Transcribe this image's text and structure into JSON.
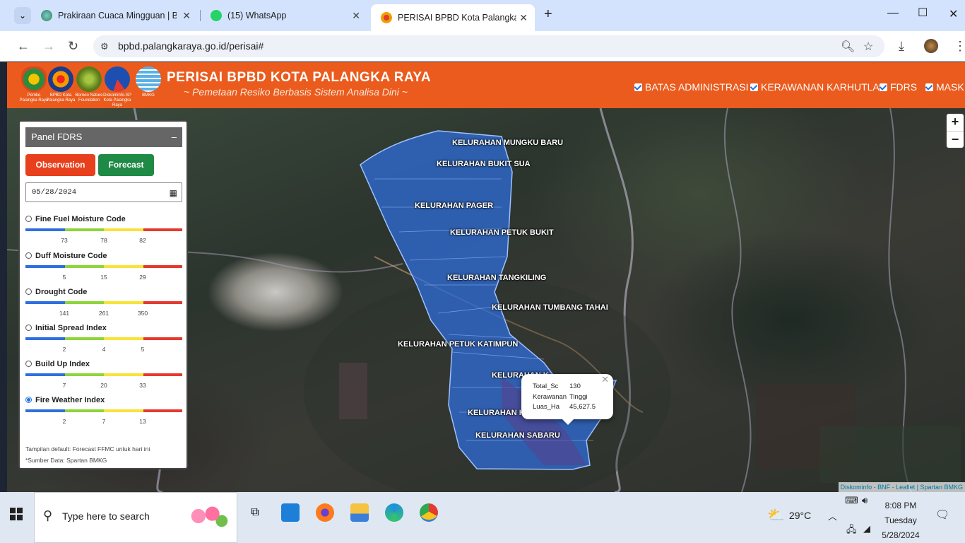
{
  "browser": {
    "tabs": [
      {
        "title": "Prakiraan Cuaca Mingguan | BM",
        "active": false
      },
      {
        "title": "(15) WhatsApp",
        "active": false
      },
      {
        "title": "PERISAI BPBD Kota Palangka Ra",
        "active": true
      }
    ],
    "url": "bpbd.palangkaraya.go.id/perisai#"
  },
  "header": {
    "title": "PERISAI BPBD KOTA PALANGKA RAYA",
    "subtitle": "~ Pemetaan Resiko Berbasis Sistem Analisa Dini ~",
    "logos": [
      {
        "caption": "Pemko Palangka Raya"
      },
      {
        "caption": "BPBD Kota Palangka Raya"
      },
      {
        "caption": "Borneo Nature Foundation"
      },
      {
        "caption": "Diskominfo-SP Kota Palangka Raya"
      },
      {
        "caption": "BMKG"
      }
    ],
    "layers": [
      "BATAS ADMINISTRASI",
      "KERAWANAN KARHUTLA",
      "FDRS",
      "MASK"
    ]
  },
  "panel": {
    "title": "Panel FDRS",
    "minimize": "–",
    "observation": "Observation",
    "forecast": "Forecast",
    "date": "05/28/2024",
    "indices": [
      {
        "name": "Fine Fuel Moisture Code",
        "ticks": [
          "73",
          "78",
          "82"
        ],
        "selected": false
      },
      {
        "name": "Duff Moisture Code",
        "ticks": [
          "5",
          "15",
          "29"
        ],
        "selected": false
      },
      {
        "name": "Drought Code",
        "ticks": [
          "141",
          "261",
          "350"
        ],
        "selected": false
      },
      {
        "name": "Initial Spread Index",
        "ticks": [
          "2",
          "4",
          "5"
        ],
        "selected": false
      },
      {
        "name": "Build Up Index",
        "ticks": [
          "7",
          "20",
          "33"
        ],
        "selected": false
      },
      {
        "name": "Fire Weather Index",
        "ticks": [
          "2",
          "7",
          "13"
        ],
        "selected": true
      }
    ],
    "scale_colors": [
      "#2f6fe0",
      "#8fd43a",
      "#f7e33a",
      "#e53a2f"
    ],
    "footer1": "Tampilan default: Forecast FFMC untuk hari ini",
    "footer2": "*Sumber Data: Spartan BMKG"
  },
  "map": {
    "labels": [
      "KELURAHAN MUNGKU BARU",
      "KELURAHAN BUKIT SUA",
      "KELURAHAN PAGER",
      "KELURAHAN PETUK BUKIT",
      "KELURAHAN TANGKILING",
      "KELURAHAN TUMBANG TAHAI",
      "KELURAHAN PETUK KATIMPUN",
      "KELURAHAN K",
      "KELURAHAN K",
      "KELURAHAN SABARU"
    ],
    "popup": {
      "rows": [
        {
          "key": "Total_Sc",
          "value": "130"
        },
        {
          "key": "Kerawanan",
          "value": "Tinggi"
        },
        {
          "key": "Luas_Ha",
          "value": "45,627.5"
        }
      ]
    },
    "zoom_in": "+",
    "zoom_out": "−",
    "attribution": "Diskominfo - BNF - Leaflet | Spartan BMKG"
  },
  "taskbar": {
    "search_placeholder": "Type here to search",
    "temperature": "29°C",
    "time": "8:08 PM",
    "day": "Tuesday",
    "date": "5/28/2024"
  }
}
